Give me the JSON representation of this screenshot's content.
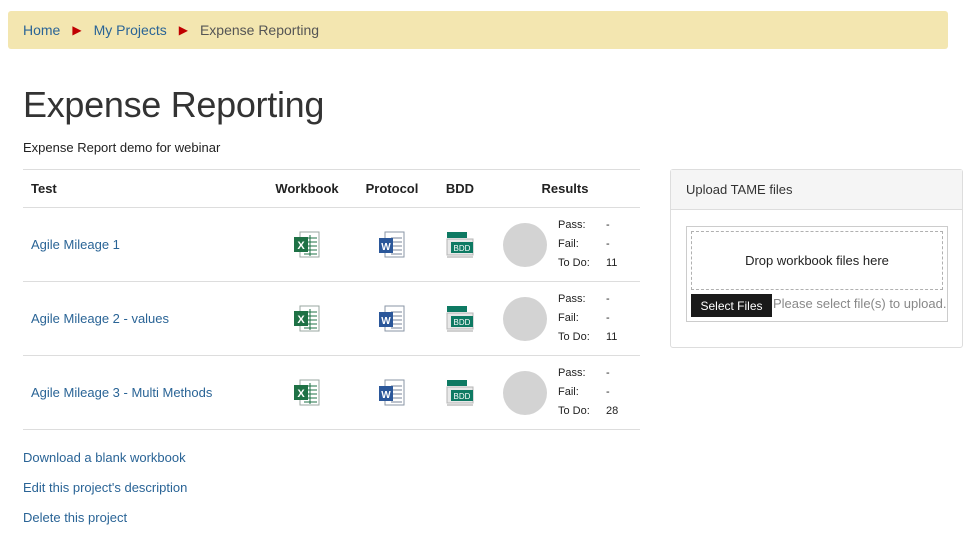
{
  "breadcrumb": {
    "home": "Home",
    "projects": "My Projects",
    "current": "Expense Reporting",
    "separator": "▶"
  },
  "page": {
    "title": "Expense Reporting",
    "description": "Expense Report demo for webinar"
  },
  "table": {
    "headers": {
      "test": "Test",
      "workbook": "Workbook",
      "protocol": "Protocol",
      "bdd": "BDD",
      "results": "Results"
    },
    "rows": [
      {
        "name": "Agile Mileage 1",
        "pass_label": "Pass:",
        "pass": "-",
        "fail_label": "Fail:",
        "fail": "-",
        "todo_label": "To Do:",
        "todo": "11"
      },
      {
        "name": "Agile Mileage 2 - values",
        "pass_label": "Pass:",
        "pass": "-",
        "fail_label": "Fail:",
        "fail": "-",
        "todo_label": "To Do:",
        "todo": "11"
      },
      {
        "name": "Agile Mileage 3 - Multi Methods",
        "pass_label": "Pass:",
        "pass": "-",
        "fail_label": "Fail:",
        "fail": "-",
        "todo_label": "To Do:",
        "todo": "28"
      }
    ],
    "icons": {
      "workbook": "excel-icon",
      "protocol": "word-icon",
      "bdd": "bdd-icon",
      "excel_letter": "X",
      "word_letter": "W",
      "bdd_text": "BDD"
    }
  },
  "links": {
    "download": "Download a blank workbook",
    "edit": "Edit this project's description",
    "delete": "Delete this project"
  },
  "upload": {
    "title": "Upload TAME files",
    "drop_text": "Drop workbook files here",
    "button": "Select Files",
    "hint": "Please select file(s) to upload."
  },
  "colors": {
    "link": "#2a6496",
    "breadcrumb_bg": "#f3e6b0",
    "separator": "#c00000",
    "excel": "#1e7145",
    "word": "#2b579a",
    "bdd": "#0e7a63",
    "result_circle": "#d3d3d3"
  }
}
